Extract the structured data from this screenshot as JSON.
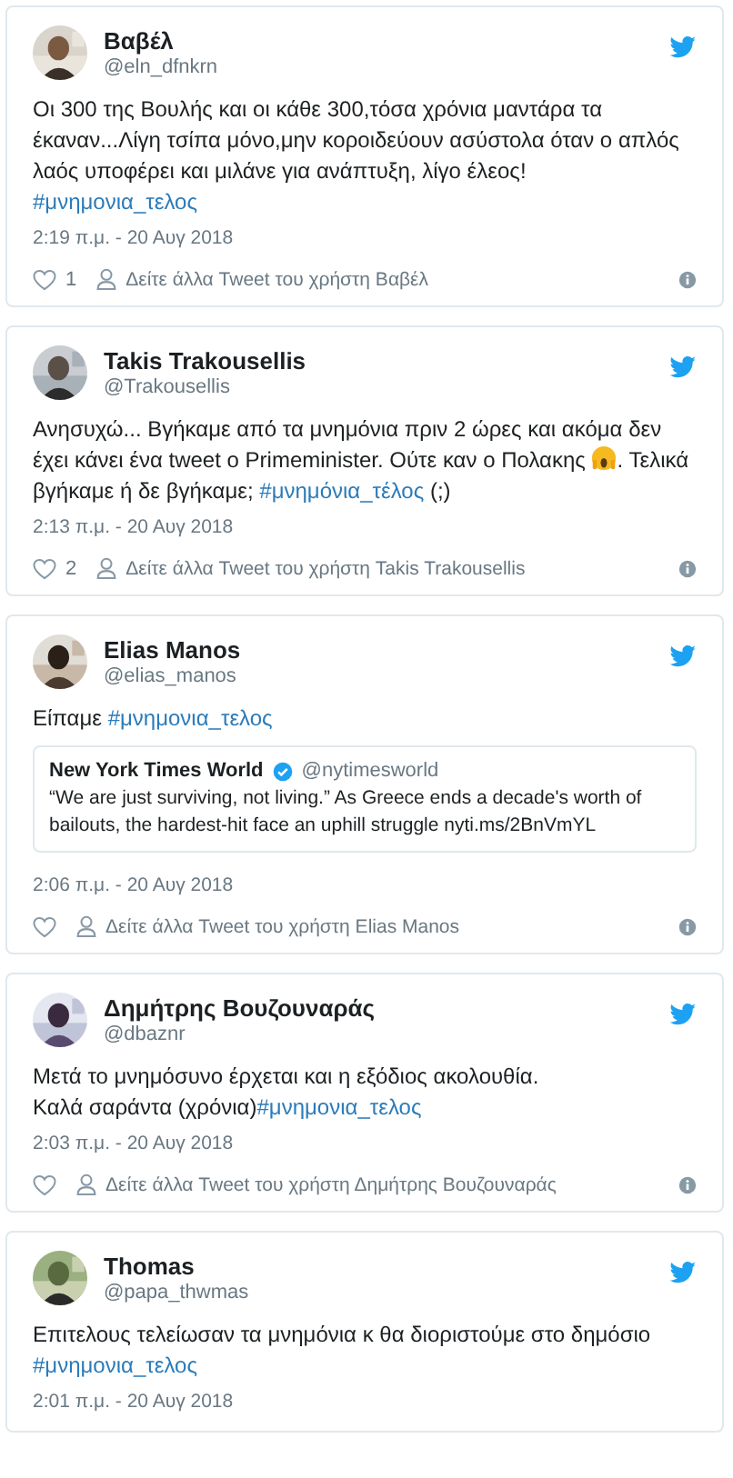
{
  "tweets": [
    {
      "name": "Βαβέλ",
      "handle": "@eln_dfnkrn",
      "body": [
        {
          "kind": "text",
          "text": "Οι 300 της Βουλής και οι κάθε 300,τόσα χρόνια μαντάρα τα έκαναν...Λίγη τσίπα μόνο,μην κοροιδεύουν ασύστολα όταν ο απλός λαός υποφέρει και μιλάνε για ανάπτυξη, λίγο έλεος! "
        },
        {
          "kind": "hashtag",
          "text": "#μνημονια_τελος"
        }
      ],
      "time": "2:19 π.μ. - 20 Αυγ 2018",
      "likes": "1",
      "more": "Δείτε άλλα Tweet του χρήστη Βαβέλ"
    },
    {
      "name": "Takis Trakousellis",
      "handle": "@Trakousellis",
      "body": [
        {
          "kind": "text",
          "text": "Ανησυχώ... Βγήκαμε από τα μνημόνια πριν 2 ώρες και ακόμα δεν έχει κάνει ένα tweet ο Primeminister. Ούτε καν ο Πολακης "
        },
        {
          "kind": "emoji"
        },
        {
          "kind": "text",
          "text": ". Τελικά βγήκαμε ή δε βγήκαμε; "
        },
        {
          "kind": "hashtag",
          "text": "#μνημόνια_τέλος"
        },
        {
          "kind": "text",
          "text": " (;)"
        }
      ],
      "time": "2:13 π.μ. - 20 Αυγ 2018",
      "likes": "2",
      "more": "Δείτε άλλα Tweet του χρήστη Takis Trakousellis"
    },
    {
      "name": "Elias Manos",
      "handle": "@elias_manos",
      "body": [
        {
          "kind": "text",
          "text": "Είπαμε "
        },
        {
          "kind": "hashtag",
          "text": "#μνημονια_τελος"
        }
      ],
      "quote": {
        "name": "New York Times World",
        "verified": true,
        "handle": "@nytimesworld",
        "text": "“We are just surviving, not living.” As Greece ends a decade's worth of bailouts, the hardest-hit face an uphill struggle nyti.ms/2BnVmYL"
      },
      "time": "2:06 π.μ. - 20 Αυγ 2018",
      "more": "Δείτε άλλα Tweet του χρήστη Elias Manos"
    },
    {
      "name": "Δημήτρης Βουζουναράς",
      "handle": "@dbaznr",
      "body": [
        {
          "kind": "text",
          "text": "Μετά το μνημόσυνο έρχεται και η εξόδιος ακολουθία.\nΚαλά σαράντα (χρόνια)"
        },
        {
          "kind": "hashtag",
          "text": "#μνημονια_τελος"
        }
      ],
      "time": "2:03 π.μ. - 20 Αυγ 2018",
      "more": "Δείτε άλλα Tweet του χρήστη Δημήτρης Βουζουναράς"
    },
    {
      "name": "Thomas",
      "handle": "@papa_thwmas",
      "body": [
        {
          "kind": "text",
          "text": "Επιτελους τελείωσαν τα μνημόνια κ θα διοριστούμε στο δημόσιο "
        },
        {
          "kind": "hashtag",
          "text": "#μνημονια_τελος"
        }
      ],
      "time": "2:01 π.μ. - 20 Αυγ 2018"
    }
  ]
}
